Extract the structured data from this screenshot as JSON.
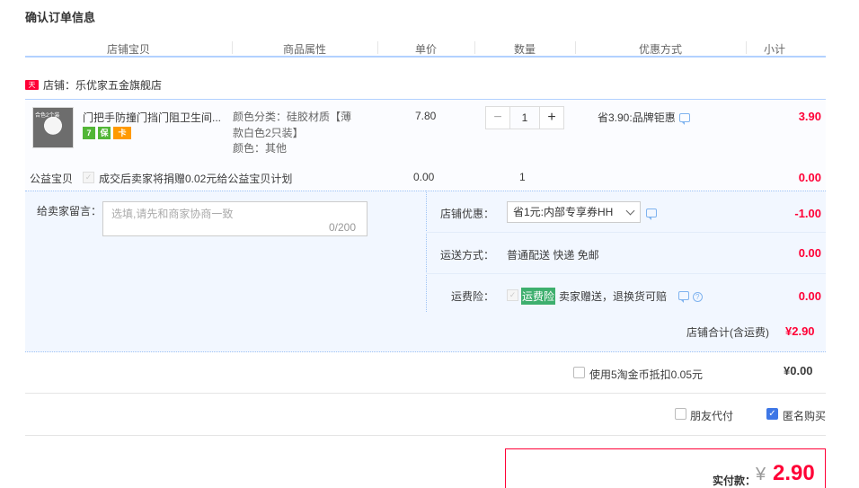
{
  "title": "确认订单信息",
  "columns": [
    "店铺宝贝",
    "商品属性",
    "单价",
    "数量",
    "优惠方式",
    "小计"
  ],
  "shop": {
    "tag": "天猫",
    "name": "店铺：乐优家五金旗舰店"
  },
  "item": {
    "thumb_text": "合色2个装",
    "name": "门把手防撞门挡门阻卫生间...",
    "badges": [
      "7",
      "保",
      "卡"
    ],
    "attr_line1": "颜色分类：硅胶材质【薄款白色2只装】",
    "attr_line2": "颜色：其他",
    "price": "7.80",
    "qty": "1",
    "qty_minus": "−",
    "qty_plus": "+",
    "promo": "省3.90:品牌钜惠",
    "subtotal": "3.90"
  },
  "charity": {
    "label": "公益宝贝",
    "check": "✓",
    "text": "成交后卖家将捐赠0.02元给公益宝贝计划",
    "price": "0.00",
    "qty": "1",
    "subtotal": "0.00"
  },
  "message": {
    "label": "给卖家留言：",
    "placeholder": "选填,请先和商家协商一致",
    "count": "0/200"
  },
  "shop_discount": {
    "label": "店铺优惠：",
    "value": "省1元:内部专享券HH",
    "amount": "-1.00"
  },
  "shipping": {
    "label": "运送方式：",
    "value": "普通配送 快递 免邮",
    "amount": "0.00"
  },
  "insurance": {
    "label": "运费险：",
    "check": "✓",
    "tag": "运费险",
    "text": "卖家赠送，退换货可赔",
    "help": "?",
    "amount": "0.00"
  },
  "shop_total": {
    "label": "店铺合计(含运费)",
    "value": "¥2.90"
  },
  "coins": {
    "text": "使用5淘金币抵扣0.05元",
    "value": "¥0.00"
  },
  "options": {
    "friend_pay": "朋友代付",
    "anonymous": "匿名购买",
    "anon_check": "✓"
  },
  "payment": {
    "label": "实付款：",
    "currency": "¥",
    "amount": "2.90"
  }
}
